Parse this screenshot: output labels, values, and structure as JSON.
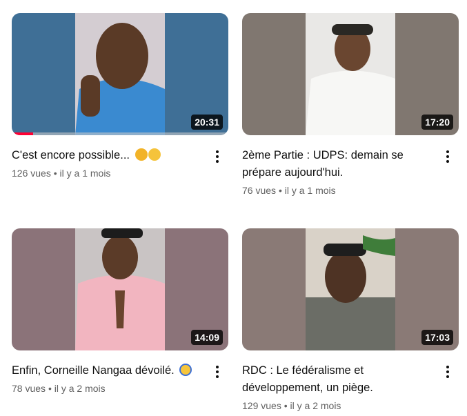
{
  "videos": [
    {
      "title": "C'est encore possible...",
      "emoji": [
        "raised-fist-emoji",
        "pensive-face-emoji"
      ],
      "duration": "20:31",
      "views": "126 vues",
      "age": "il y a 1 mois",
      "watched_fraction": 0.1
    },
    {
      "title": "2ème Partie : UDPS: demain se prépare aujourd'hui.",
      "duration": "17:20",
      "views": "76 vues",
      "age": "il y a 1 mois"
    },
    {
      "title": "Enfin, Corneille Nangaa dévoilé.",
      "emoji": [
        "screaming-face-emoji"
      ],
      "duration": "14:09",
      "views": "78 vues",
      "age": "il y a 2 mois"
    },
    {
      "title": "RDC : Le fédéralisme et développement, un piège.",
      "duration": "17:03",
      "views": "129 vues",
      "age": "il y a 2 mois"
    }
  ],
  "meta_separator": "•",
  "colors": {
    "progress": "#ff0033",
    "text_primary": "#0f0f0f",
    "text_secondary": "#606060"
  }
}
